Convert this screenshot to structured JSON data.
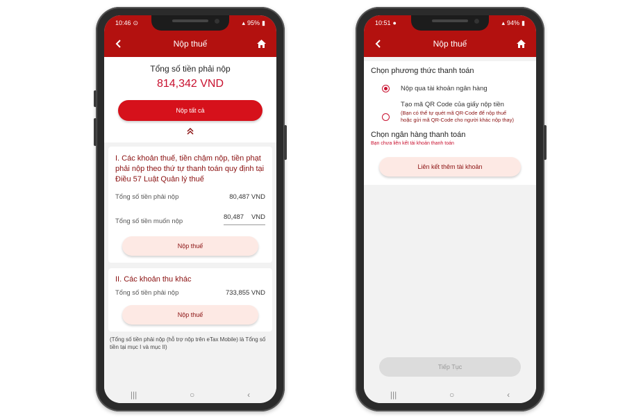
{
  "colors": {
    "header": "#b3110f",
    "primary_button": "#d6111b",
    "soft_button": "#fde9e4",
    "accent_text": "#c8102e"
  },
  "left": {
    "status": {
      "time": "10:46",
      "battery": "95%"
    },
    "header": {
      "title": "Nộp thuế",
      "back_icon": "chevron-left-icon",
      "home_icon": "home-icon"
    },
    "summary": {
      "label": "Tổng số tiền phải nộp",
      "amount": "814,342 VND",
      "pay_all_label": "Nộp tất cả"
    },
    "collapse_icon": "double-chevron-up-icon",
    "section1": {
      "title": "I. Các khoản thuế, tiền chậm nộp, tiền phạt phải nộp theo thứ tự thanh toán quy định tại Điều 57 Luật Quản lý thuế",
      "due_label": "Tổng số tiền phải nộp",
      "due_value": "80,487 VND",
      "want_label": "Tổng số tiền muốn nộp",
      "want_value": "80,487",
      "want_unit": "VND",
      "button": "Nộp thuế"
    },
    "section2": {
      "title": "II. Các khoản thu khác",
      "due_label": "Tổng số tiền phải nộp",
      "due_value": "733,855 VND",
      "button": "Nộp thuế"
    },
    "footnote": "(Tổng số tiền phải nộp (hỗ trợ nộp trên eTax Mobile) là Tổng số tiền tại mục I và mục II)"
  },
  "right": {
    "status": {
      "time": "10:51",
      "battery": "94%"
    },
    "header": {
      "title": "Nộp thuế",
      "back_icon": "chevron-left-icon",
      "home_icon": "home-icon"
    },
    "method": {
      "title": "Chọn phương thức thanh toán",
      "option1": "Nộp qua tài khoản ngân hàng",
      "option2": "Tạo mã QR Code của giấy nộp tiền",
      "option2_note": "(Bạn có thể tự quét mã QR-Code để nộp thuế hoặc gửi mã QR-Code cho người khác nộp thay)",
      "selected": "option1"
    },
    "bank": {
      "title": "Chọn ngân hàng thanh toán",
      "subtitle": "Bạn chưa liên kết tài khoản thanh toán",
      "link_button": "Liên kết thêm tài khoản"
    },
    "continue_button": "Tiếp Tục"
  }
}
